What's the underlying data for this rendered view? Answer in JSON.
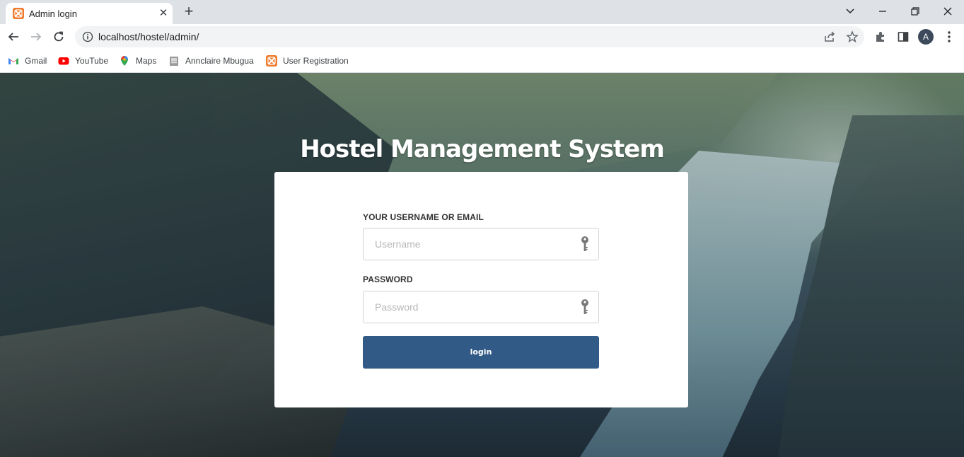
{
  "browser": {
    "tab_title": "Admin login",
    "tab_close": "✕",
    "new_tab": "+",
    "url": "localhost/hostel/admin/",
    "avatar_letter": "A",
    "bookmarks": [
      {
        "label": "Gmail",
        "icon": "gmail-icon"
      },
      {
        "label": "YouTube",
        "icon": "youtube-icon"
      },
      {
        "label": "Maps",
        "icon": "maps-icon"
      },
      {
        "label": "Annclaire Mbugua",
        "icon": "page-icon"
      },
      {
        "label": "User Registration",
        "icon": "xampp-icon"
      }
    ]
  },
  "page": {
    "title": "Hostel Management System",
    "username_label": "YOUR USERNAME OR EMAIL",
    "username_placeholder": "Username",
    "username_value": "",
    "password_label": "PASSWORD",
    "password_placeholder": "Password",
    "password_value": "",
    "login_label": "login"
  },
  "colors": {
    "login_button": "#325a86",
    "card": "#ffffff",
    "label_text": "#333333"
  }
}
